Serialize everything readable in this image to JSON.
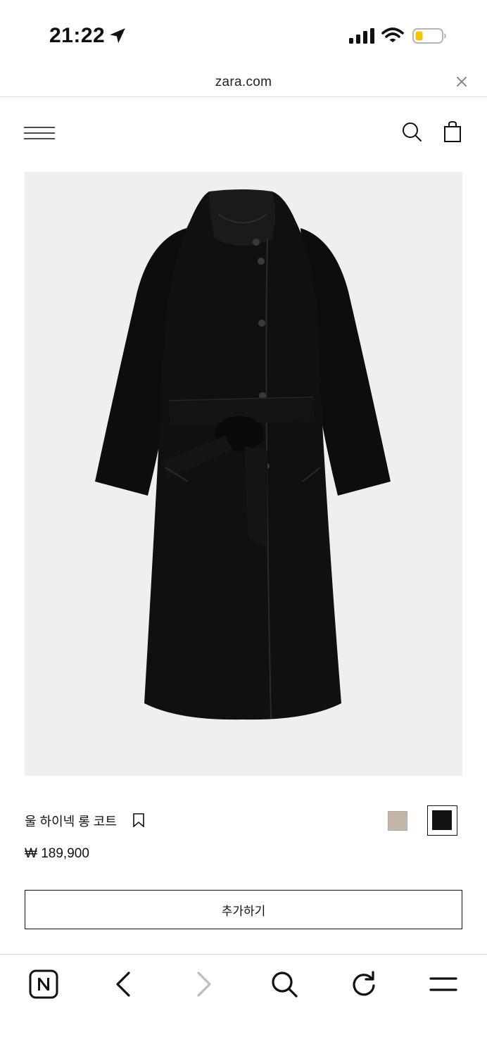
{
  "status_bar": {
    "time": "21:22",
    "icons": [
      "location-arrow-icon",
      "cellular-signal-icon",
      "wifi-icon",
      "battery-low-icon"
    ],
    "battery_color": "#f5c400"
  },
  "browser": {
    "url": "zara.com",
    "close_icon": "close-icon"
  },
  "header": {
    "menu_icon": "hamburger-menu-icon",
    "search_icon": "search-icon",
    "bag_icon": "shopping-bag-icon"
  },
  "product": {
    "image_icon": "black-long-coat-image",
    "name": "울 하이넥 롱 코트",
    "price": "₩ 189,900",
    "colors": [
      "#c3b5a7",
      "#111111"
    ],
    "selected_color": "#111111",
    "add_button": "추가하기"
  },
  "toolbar": {
    "items": [
      "naver-n-icon",
      "back-arrow-icon",
      "forward-arrow-icon",
      "search-icon",
      "reload-icon",
      "menu-icon"
    ]
  }
}
